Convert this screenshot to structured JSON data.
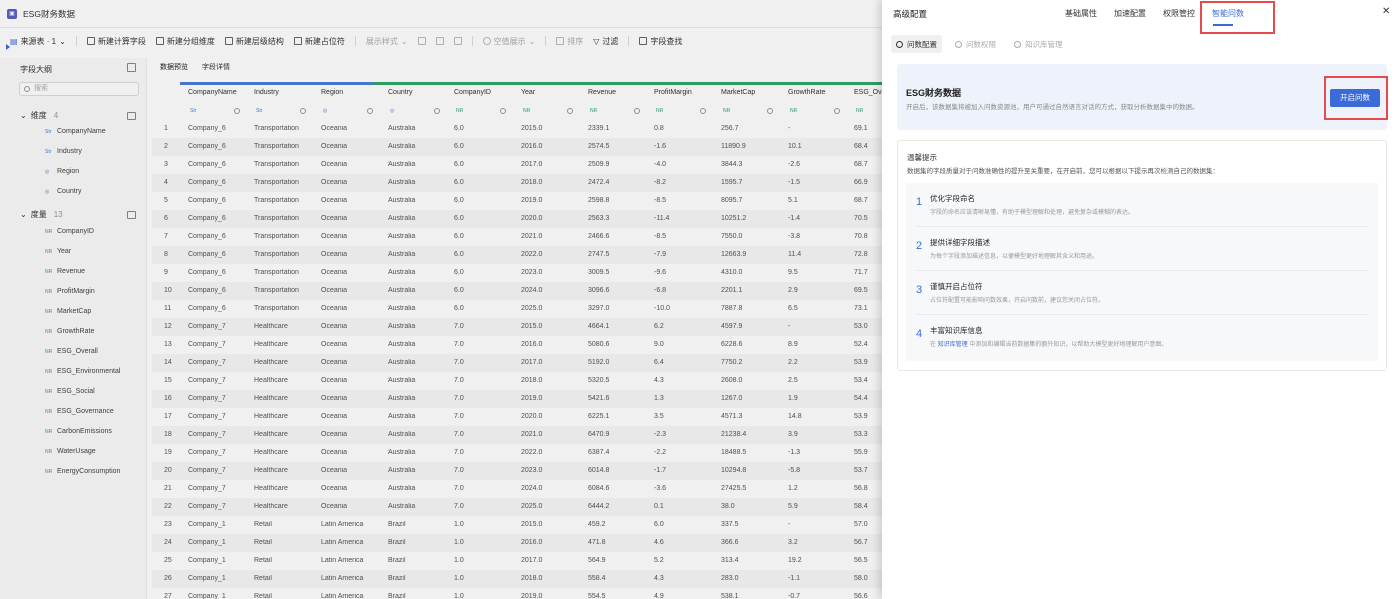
{
  "app": {
    "title": "ESG财务数据",
    "icon": "app-icon"
  },
  "toolbar": {
    "source": "来源表 · 1",
    "items": [
      {
        "label": "新建计算字段",
        "icon": "calc-field-icon",
        "enabled": true
      },
      {
        "label": "新建分组维度",
        "icon": "group-icon",
        "enabled": true
      },
      {
        "label": "新建层级结构",
        "icon": "hierarchy-icon",
        "enabled": true
      },
      {
        "label": "新建占位符",
        "icon": "placeholder-icon",
        "enabled": true
      },
      {
        "label": "展示样式",
        "icon": "",
        "enabled": false
      },
      {
        "label": "空值展示",
        "icon": "null-icon",
        "enabled": false
      },
      {
        "label": "排序",
        "icon": "sort-icon",
        "enabled": false
      },
      {
        "label": "过滤",
        "icon": "filter-icon",
        "enabled": true
      },
      {
        "label": "字段查找",
        "icon": "find-field-icon",
        "enabled": true
      }
    ]
  },
  "outline": {
    "title": "字段大纲",
    "search_placeholder": "搜索",
    "dimension": {
      "label": "维度",
      "count": "4",
      "fields": [
        {
          "type": "Str",
          "name": "CompanyName"
        },
        {
          "type": "Str",
          "name": "Industry"
        },
        {
          "type": "geo",
          "name": "Region"
        },
        {
          "type": "geo",
          "name": "Country"
        }
      ]
    },
    "measure": {
      "label": "度量",
      "count": "13",
      "fields": [
        "CompanyID",
        "Year",
        "Revenue",
        "ProfitMargin",
        "MarketCap",
        "GrowthRate",
        "ESG_Overall",
        "ESG_Environmental",
        "ESG_Social",
        "ESG_Governance",
        "CarbonEmissions",
        "WaterUsage",
        "EnergyConsumption"
      ]
    }
  },
  "data_tabs": [
    "数据预览",
    "字段详情"
  ],
  "table": {
    "columns": [
      "CompanyName",
      "Industry",
      "Region",
      "Country",
      "CompanyID",
      "Year",
      "Revenue",
      "ProfitMargin",
      "MarketCap",
      "GrowthRate",
      "ESG_Ov"
    ],
    "subtags": [
      "Str",
      "Str",
      "geo",
      "geo",
      "NR",
      "NR",
      "NR",
      "NR",
      "NR",
      "NR",
      "NR"
    ],
    "rows": [
      [
        "1",
        "Company_6",
        "Transportation",
        "Oceania",
        "Australia",
        "6.0",
        "2015.0",
        "2339.1",
        "0.8",
        "256.7",
        "-",
        "69.1"
      ],
      [
        "2",
        "Company_6",
        "Transportation",
        "Oceania",
        "Australia",
        "6.0",
        "2016.0",
        "2574.5",
        "-1.6",
        "11890.9",
        "10.1",
        "68.4"
      ],
      [
        "3",
        "Company_6",
        "Transportation",
        "Oceania",
        "Australia",
        "6.0",
        "2017.0",
        "2509.9",
        "-4.0",
        "3844.3",
        "-2.6",
        "68.7"
      ],
      [
        "4",
        "Company_6",
        "Transportation",
        "Oceania",
        "Australia",
        "6.0",
        "2018.0",
        "2472.4",
        "-8.2",
        "1595.7",
        "-1.5",
        "66.9"
      ],
      [
        "5",
        "Company_6",
        "Transportation",
        "Oceania",
        "Australia",
        "6.0",
        "2019.0",
        "2598.8",
        "-8.5",
        "8095.7",
        "5.1",
        "68.7"
      ],
      [
        "6",
        "Company_6",
        "Transportation",
        "Oceania",
        "Australia",
        "6.0",
        "2020.0",
        "2563.3",
        "-11.4",
        "10251.2",
        "-1.4",
        "70.5"
      ],
      [
        "7",
        "Company_6",
        "Transportation",
        "Oceania",
        "Australia",
        "6.0",
        "2021.0",
        "2466.6",
        "-8.5",
        "7550.0",
        "-3.8",
        "70.8"
      ],
      [
        "8",
        "Company_6",
        "Transportation",
        "Oceania",
        "Australia",
        "6.0",
        "2022.0",
        "2747.5",
        "-7.9",
        "12663.9",
        "11.4",
        "72.8"
      ],
      [
        "9",
        "Company_6",
        "Transportation",
        "Oceania",
        "Australia",
        "6.0",
        "2023.0",
        "3009.5",
        "-9.6",
        "4310.0",
        "9.5",
        "71.7"
      ],
      [
        "10",
        "Company_6",
        "Transportation",
        "Oceania",
        "Australia",
        "6.0",
        "2024.0",
        "3096.6",
        "-6.8",
        "2201.1",
        "2.9",
        "69.5"
      ],
      [
        "11",
        "Company_6",
        "Transportation",
        "Oceania",
        "Australia",
        "6.0",
        "2025.0",
        "3297.0",
        "-10.0",
        "7887.8",
        "6.5",
        "73.1"
      ],
      [
        "12",
        "Company_7",
        "Healthcare",
        "Oceania",
        "Australia",
        "7.0",
        "2015.0",
        "4664.1",
        "6.2",
        "4597.9",
        "-",
        "53.0"
      ],
      [
        "13",
        "Company_7",
        "Healthcare",
        "Oceania",
        "Australia",
        "7.0",
        "2016.0",
        "5080.6",
        "9.0",
        "6228.6",
        "8.9",
        "52.4"
      ],
      [
        "14",
        "Company_7",
        "Healthcare",
        "Oceania",
        "Australia",
        "7.0",
        "2017.0",
        "5192.0",
        "6.4",
        "7750.2",
        "2.2",
        "53.9"
      ],
      [
        "15",
        "Company_7",
        "Healthcare",
        "Oceania",
        "Australia",
        "7.0",
        "2018.0",
        "5320.5",
        "4.3",
        "2608.0",
        "2.5",
        "53.4"
      ],
      [
        "16",
        "Company_7",
        "Healthcare",
        "Oceania",
        "Australia",
        "7.0",
        "2019.0",
        "5421.6",
        "1.3",
        "1267.0",
        "1.9",
        "54.4"
      ],
      [
        "17",
        "Company_7",
        "Healthcare",
        "Oceania",
        "Australia",
        "7.0",
        "2020.0",
        "6225.1",
        "3.5",
        "4571.3",
        "14.8",
        "53.9"
      ],
      [
        "18",
        "Company_7",
        "Healthcare",
        "Oceania",
        "Australia",
        "7.0",
        "2021.0",
        "6470.9",
        "-2.3",
        "21238.4",
        "3.9",
        "53.3"
      ],
      [
        "19",
        "Company_7",
        "Healthcare",
        "Oceania",
        "Australia",
        "7.0",
        "2022.0",
        "6387.4",
        "-2.2",
        "18488.5",
        "-1.3",
        "55.9"
      ],
      [
        "20",
        "Company_7",
        "Healthcare",
        "Oceania",
        "Australia",
        "7.0",
        "2023.0",
        "6014.8",
        "-1.7",
        "10294.8",
        "-5.8",
        "53.7"
      ],
      [
        "21",
        "Company_7",
        "Healthcare",
        "Oceania",
        "Australia",
        "7.0",
        "2024.0",
        "6084.6",
        "-3.6",
        "27425.5",
        "1.2",
        "56.8"
      ],
      [
        "22",
        "Company_7",
        "Healthcare",
        "Oceania",
        "Australia",
        "7.0",
        "2025.0",
        "6444.2",
        "0.1",
        "38.0",
        "5.9",
        "58.4"
      ],
      [
        "23",
        "Company_1",
        "Retail",
        "Latin America",
        "Brazil",
        "1.0",
        "2015.0",
        "459.2",
        "6.0",
        "337.5",
        "-",
        "57.0"
      ],
      [
        "24",
        "Company_1",
        "Retail",
        "Latin America",
        "Brazil",
        "1.0",
        "2016.0",
        "471.8",
        "4.6",
        "366.6",
        "3.2",
        "56.7"
      ],
      [
        "25",
        "Company_1",
        "Retail",
        "Latin America",
        "Brazil",
        "1.0",
        "2017.0",
        "564.9",
        "5.2",
        "313.4",
        "19.2",
        "56.5"
      ],
      [
        "26",
        "Company_1",
        "Retail",
        "Latin America",
        "Brazil",
        "1.0",
        "2018.0",
        "558.4",
        "4.3",
        "283.0",
        "-1.1",
        "58.0"
      ],
      [
        "27",
        "Company_1",
        "Retail",
        "Latin America",
        "Brazil",
        "1.0",
        "2019.0",
        "554.5",
        "4.9",
        "538.1",
        "-0.7",
        "56.6"
      ]
    ]
  },
  "panel": {
    "title": "高级配置",
    "tabs": [
      "基础属性",
      "加速配置",
      "权限管控",
      "智能问数"
    ],
    "active_tab": "智能问数",
    "subtabs": [
      {
        "label": "问数配置",
        "enabled": true
      },
      {
        "label": "问数权限",
        "enabled": false
      },
      {
        "label": "知识库管理",
        "enabled": false
      }
    ],
    "card": {
      "title": "ESG财务数据",
      "desc": "开启后，该数据集将被加入问数资源池，用户可通过自然语言对话的方式，获取分析数据集中的数据。",
      "button": "开启问数"
    },
    "tips": {
      "title": "温馨提示",
      "desc": "数据集的字段质量对于问数准确性的提升至关重要，在开启前，您可以根据以下提示再次检测自己的数据集：",
      "steps": [
        {
          "num": "1",
          "title": "优化字段命名",
          "desc": "字段的命名应该清晰易懂，有助于模型理解和处理，避免复杂或模糊的表达。"
        },
        {
          "num": "2",
          "title": "提供详细字段描述",
          "desc": "为每个字段添加描述信息，以便模型更好地理解其含义和用途。"
        },
        {
          "num": "3",
          "title": "谨慎开启占位符",
          "desc": "占位符配置可能影响问数效果，开启问数前，建议您关闭占位符。"
        },
        {
          "num": "4",
          "title": "丰富知识库信息",
          "desc_pre": "在 ",
          "link": "知识库管理",
          "desc_post": " 中添加和编辑当前数据集的额外知识，以帮助大模型更好地理解用户意图。"
        }
      ]
    }
  },
  "colors": {
    "accent": "#3b6bd8",
    "highlight": "#e54b4b"
  }
}
